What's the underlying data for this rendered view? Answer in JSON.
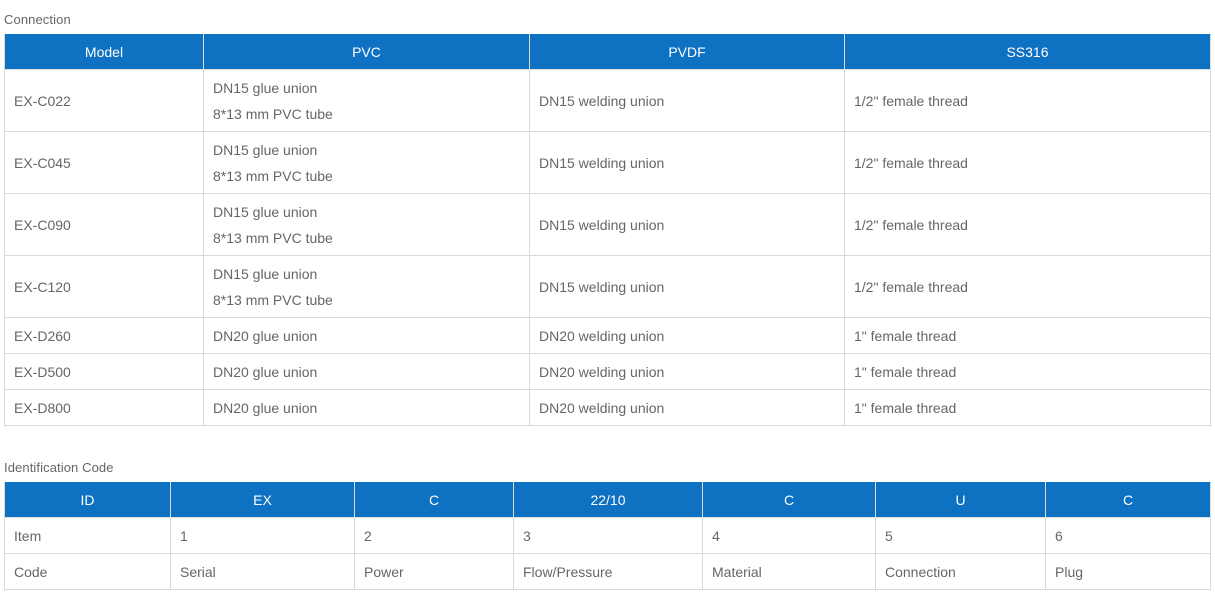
{
  "connection": {
    "title": "Connection",
    "headers": [
      "Model",
      "PVC",
      "PVDF",
      "SS316"
    ],
    "rows": [
      {
        "model": "EX-C022",
        "pvc": [
          "DN15 glue union",
          "8*13 mm PVC tube"
        ],
        "pvdf": "DN15 welding union",
        "ss316": "1/2\" female thread"
      },
      {
        "model": "EX-C045",
        "pvc": [
          "DN15 glue union",
          "8*13 mm PVC tube"
        ],
        "pvdf": "DN15 welding union",
        "ss316": "1/2\" female thread"
      },
      {
        "model": "EX-C090",
        "pvc": [
          "DN15 glue union",
          "8*13 mm PVC tube"
        ],
        "pvdf": "DN15 welding union",
        "ss316": "1/2\" female thread"
      },
      {
        "model": "EX-C120",
        "pvc": [
          "DN15 glue union",
          "8*13 mm PVC tube"
        ],
        "pvdf": "DN15 welding union",
        "ss316": "1/2\" female thread"
      },
      {
        "model": "EX-D260",
        "pvc": [
          "DN20 glue union"
        ],
        "pvdf": "DN20 welding union",
        "ss316": "1\" female thread"
      },
      {
        "model": "EX-D500",
        "pvc": [
          "DN20 glue union"
        ],
        "pvdf": "DN20 welding union",
        "ss316": "1\" female thread"
      },
      {
        "model": "EX-D800",
        "pvc": [
          "DN20 glue union"
        ],
        "pvdf": "DN20 welding union",
        "ss316": "1\" female thread"
      }
    ]
  },
  "identification": {
    "title": "Identification Code",
    "headers": [
      "ID",
      "EX",
      "C",
      "22/10",
      "C",
      "U",
      "C"
    ],
    "rows": [
      [
        "Item",
        "1",
        "2",
        "3",
        "4",
        "5",
        "6"
      ],
      [
        "Code",
        "Serial",
        "Power",
        "Flow/Pressure",
        "Material",
        "Connection",
        "Plug"
      ]
    ]
  },
  "colors": {
    "header_bg": "#0f71c2",
    "header_text": "#ffffff",
    "body_text": "#666666",
    "border": "#d9d9d9"
  }
}
